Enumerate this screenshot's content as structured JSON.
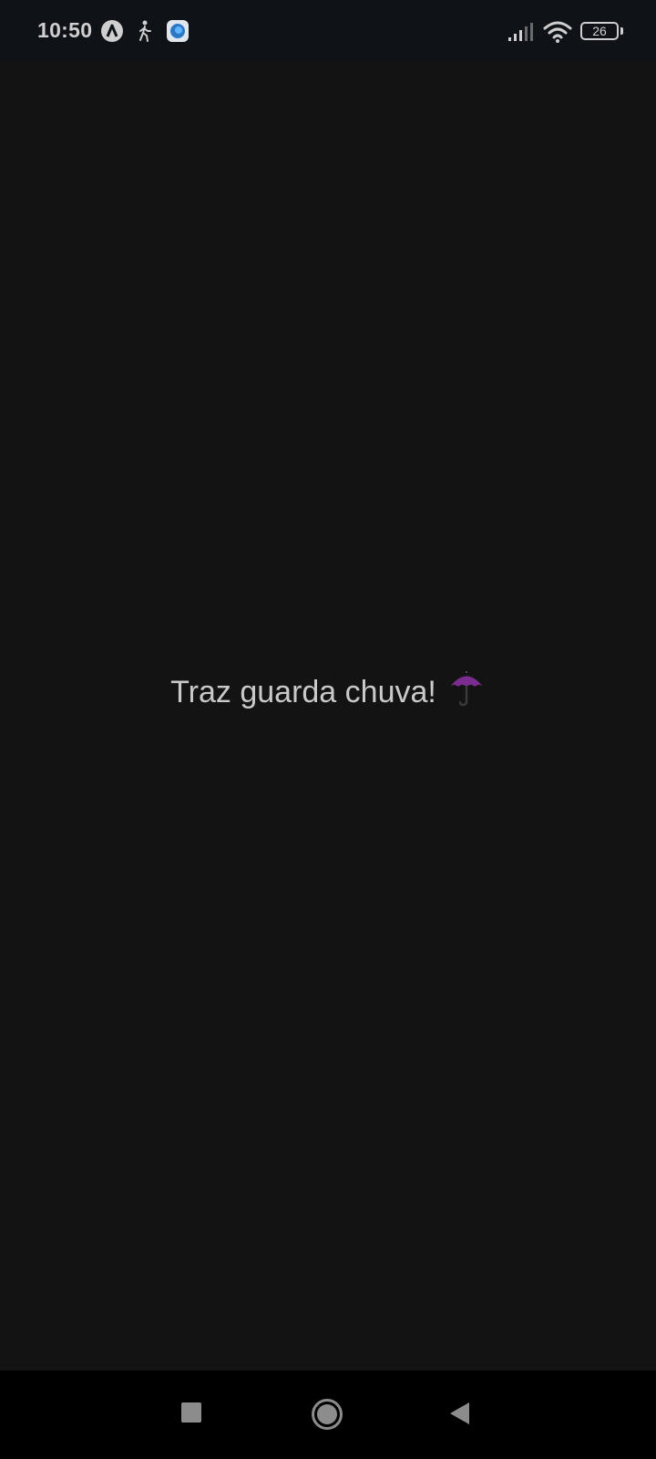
{
  "status_bar": {
    "time": "10:50",
    "icons": [
      "app-a-icon",
      "walking-person-icon",
      "browser-app-icon",
      "signal-icon",
      "wifi-icon",
      "battery-icon"
    ],
    "battery_level": "26"
  },
  "main": {
    "message": "Traz guarda chuva!",
    "emoji_icon": "umbrella-icon",
    "text_color": "#c9c9c9",
    "background_color": "#131313"
  },
  "nav_bar": {
    "buttons": [
      "recents-button",
      "home-button",
      "back-button"
    ]
  }
}
